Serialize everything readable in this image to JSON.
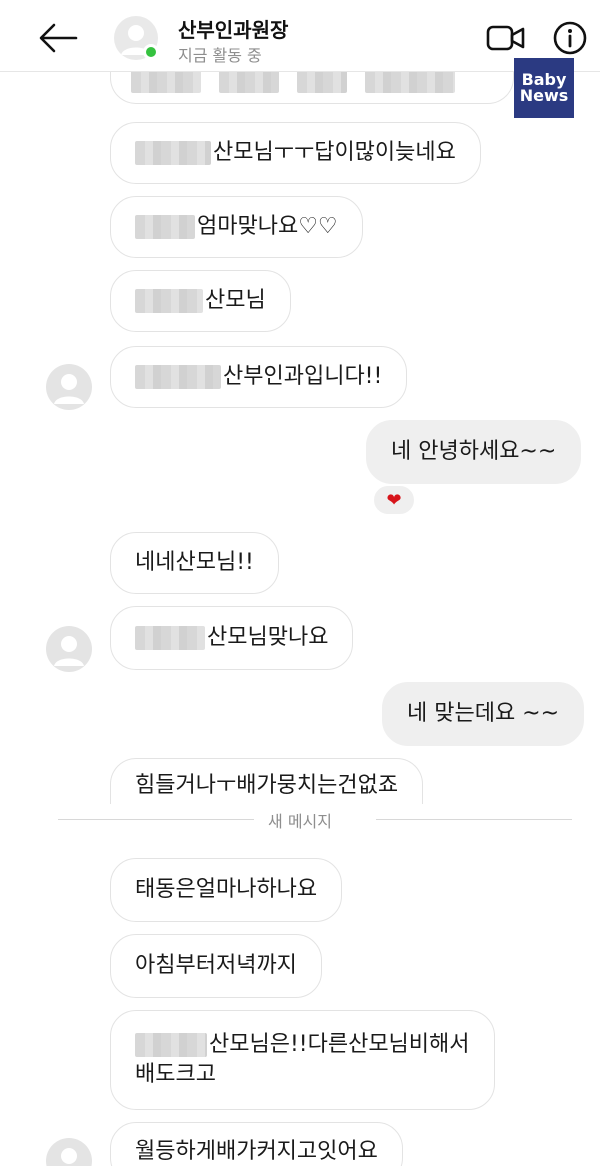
{
  "header": {
    "contact_name": "산부인과원장",
    "status": "지금 활동 중",
    "back_icon": "arrow-left-icon",
    "video_icon": "video-camera-icon",
    "info_icon": "info-circle-icon",
    "online_color": "#35c23f"
  },
  "logo": {
    "line1": "Baby",
    "line2": "News"
  },
  "messages": [
    {
      "text": "산모님ㅜㅜ답이많이늦네요"
    },
    {
      "text": "엄마맞나요♡♡"
    },
    {
      "text": "산모님"
    },
    {
      "text": "산부인과입니다!!"
    },
    {
      "text": "네 안녕하세요~~"
    },
    {
      "text": "네네산모님!!"
    },
    {
      "text": "산모님맞나요"
    },
    {
      "text": "네 맞는데요 ~~"
    },
    {
      "text": "힘들거나ㅜ배가뭉치는건없죠"
    },
    {
      "text": "태동은얼마나하나요"
    },
    {
      "text": "아침부터저녁까지"
    },
    {
      "line1": "산모님은!!다른산모님비해서",
      "line2": "배도크고"
    },
    {
      "text": "월등하게배가커지고잇어요"
    }
  ],
  "reaction": {
    "emoji": "❤",
    "color": "#d7141a"
  },
  "divider_label": "새 메시지"
}
